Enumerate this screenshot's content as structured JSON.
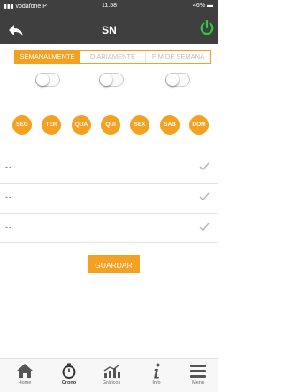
{
  "status_bar": {
    "carrier": "vodafone P",
    "time": "11:58",
    "battery": "46%"
  },
  "header": {
    "title": "SN",
    "back_icon": "back-arrow-icon",
    "power_icon": "power-icon",
    "power_color": "#2ecc40"
  },
  "accent_color": "#f4a020",
  "schedule_tabs": [
    {
      "label": "SEMANALMENTE",
      "active": true
    },
    {
      "label": "DIARIAMENTE",
      "active": false
    },
    {
      "label": "FIM DE SEMANA",
      "active": false
    }
  ],
  "toggles": [
    false,
    false,
    false
  ],
  "days": [
    "SEG",
    "TER",
    "QUA",
    "QUI",
    "SEX",
    "SAB",
    "DOM"
  ],
  "time_rows": [
    {
      "value": "--",
      "checked_icon": "check-icon"
    },
    {
      "value": "--",
      "checked_icon": "check-icon"
    },
    {
      "value": "--",
      "checked_icon": "check-icon"
    }
  ],
  "save_label": "GUARDAR",
  "tabbar": [
    {
      "label": "Home",
      "icon": "home-icon"
    },
    {
      "label": "Crono",
      "icon": "stopwatch-icon"
    },
    {
      "label": "Gráficos",
      "icon": "chart-icon"
    },
    {
      "label": "Info",
      "icon": "info-icon"
    },
    {
      "label": "Menu",
      "icon": "menu-icon"
    }
  ]
}
